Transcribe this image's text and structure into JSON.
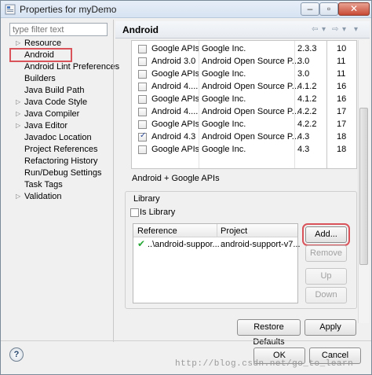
{
  "window": {
    "title": "Properties for myDemo",
    "min_glyph": "–",
    "max_glyph": "▫",
    "close_glyph": "✕"
  },
  "filter": {
    "placeholder": "type filter text"
  },
  "nav": {
    "items": [
      {
        "label": "Resource",
        "expandable": true
      },
      {
        "label": "Android",
        "expandable": false,
        "selected": true
      },
      {
        "label": "Android Lint Preferences",
        "expandable": false
      },
      {
        "label": "Builders",
        "expandable": false
      },
      {
        "label": "Java Build Path",
        "expandable": false
      },
      {
        "label": "Java Code Style",
        "expandable": true
      },
      {
        "label": "Java Compiler",
        "expandable": true
      },
      {
        "label": "Java Editor",
        "expandable": true
      },
      {
        "label": "Javadoc Location",
        "expandable": false
      },
      {
        "label": "Project References",
        "expandable": false
      },
      {
        "label": "Refactoring History",
        "expandable": false
      },
      {
        "label": "Run/Debug Settings",
        "expandable": false
      },
      {
        "label": "Task Tags",
        "expandable": false
      },
      {
        "label": "Validation",
        "expandable": true
      }
    ]
  },
  "page": {
    "title": "Android"
  },
  "targets": {
    "rows": [
      {
        "name": "Google APIs",
        "vendor": "Google Inc.",
        "platform": "2.3.3",
        "api": "10",
        "checked": false
      },
      {
        "name": "Android 3.0",
        "vendor": "Android Open Source P...",
        "platform": "3.0",
        "api": "11",
        "checked": false
      },
      {
        "name": "Google APIs",
        "vendor": "Google Inc.",
        "platform": "3.0",
        "api": "11",
        "checked": false
      },
      {
        "name": "Android 4....",
        "vendor": "Android Open Source P...",
        "platform": "4.1.2",
        "api": "16",
        "checked": false
      },
      {
        "name": "Google APIs",
        "vendor": "Google Inc.",
        "platform": "4.1.2",
        "api": "16",
        "checked": false
      },
      {
        "name": "Android 4....",
        "vendor": "Android Open Source P...",
        "platform": "4.2.2",
        "api": "17",
        "checked": false
      },
      {
        "name": "Google APIs",
        "vendor": "Google Inc.",
        "platform": "4.2.2",
        "api": "17",
        "checked": false
      },
      {
        "name": "Android 4.3",
        "vendor": "Android Open Source P...",
        "platform": "4.3",
        "api": "18",
        "checked": true
      },
      {
        "name": "Google APIs",
        "vendor": "Google Inc.",
        "platform": "4.3",
        "api": "18",
        "checked": false
      }
    ],
    "selected_label": "Android + Google APIs"
  },
  "library": {
    "legend": "Library",
    "is_library_label": "Is Library",
    "is_library_checked": false,
    "columns": [
      "Reference",
      "Project"
    ],
    "rows": [
      {
        "reference": "..\\android-suppor...",
        "project": "android-support-v7...",
        "ok": true
      }
    ],
    "buttons": {
      "add": "Add...",
      "remove": "Remove",
      "up": "Up",
      "down": "Down"
    }
  },
  "actions": {
    "restore_defaults": "Restore Defaults",
    "apply": "Apply",
    "ok": "OK",
    "cancel": "Cancel"
  },
  "help_glyph": "?",
  "watermark": "http://blog.csdn.net/go_to_learn",
  "colors": {
    "highlight_outline": "#d9535a",
    "check_green": "#27a836"
  }
}
